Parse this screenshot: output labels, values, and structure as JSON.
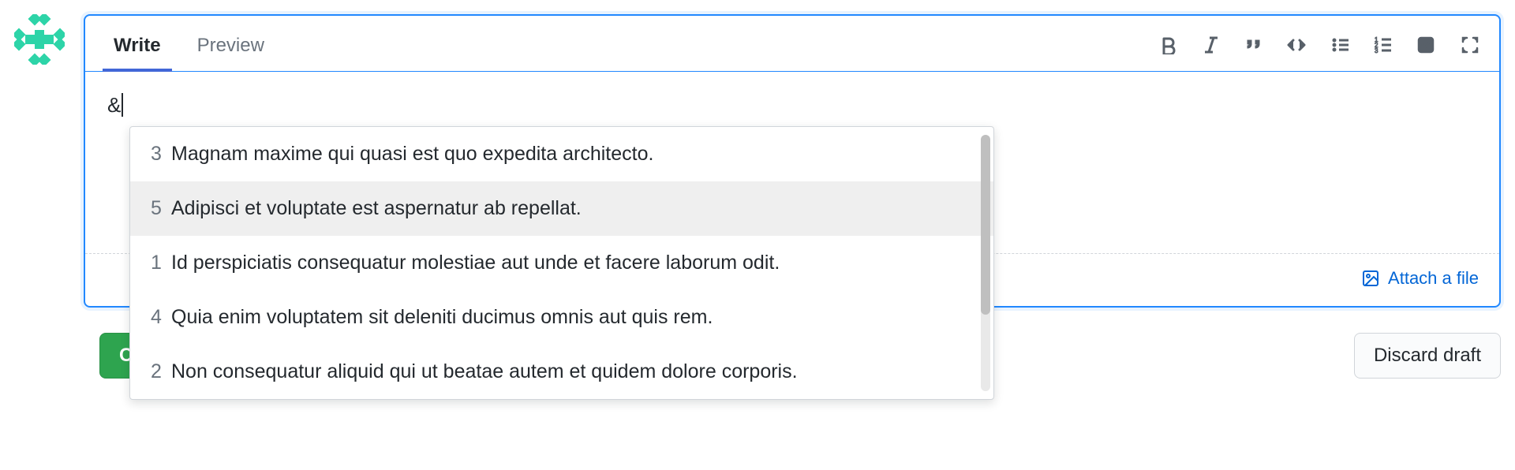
{
  "tabs": {
    "write": "Write",
    "preview": "Preview"
  },
  "editor": {
    "value": "&"
  },
  "attach": {
    "label": "Attach a file"
  },
  "buttons": {
    "primary": "C",
    "discard": "Discard draft"
  },
  "autocomplete": {
    "items": [
      {
        "num": "3",
        "title": "Magnam maxime qui quasi est quo expedita architecto."
      },
      {
        "num": "5",
        "title": "Adipisci et voluptate est aspernatur ab repellat."
      },
      {
        "num": "1",
        "title": "Id perspiciatis consequatur molestiae aut unde et facere laborum odit."
      },
      {
        "num": "4",
        "title": "Quia enim voluptatem sit deleniti ducimus omnis aut quis rem."
      },
      {
        "num": "2",
        "title": "Non consequatur aliquid qui ut beatae autem et quidem dolore corporis."
      }
    ],
    "highlight_index": 1
  }
}
